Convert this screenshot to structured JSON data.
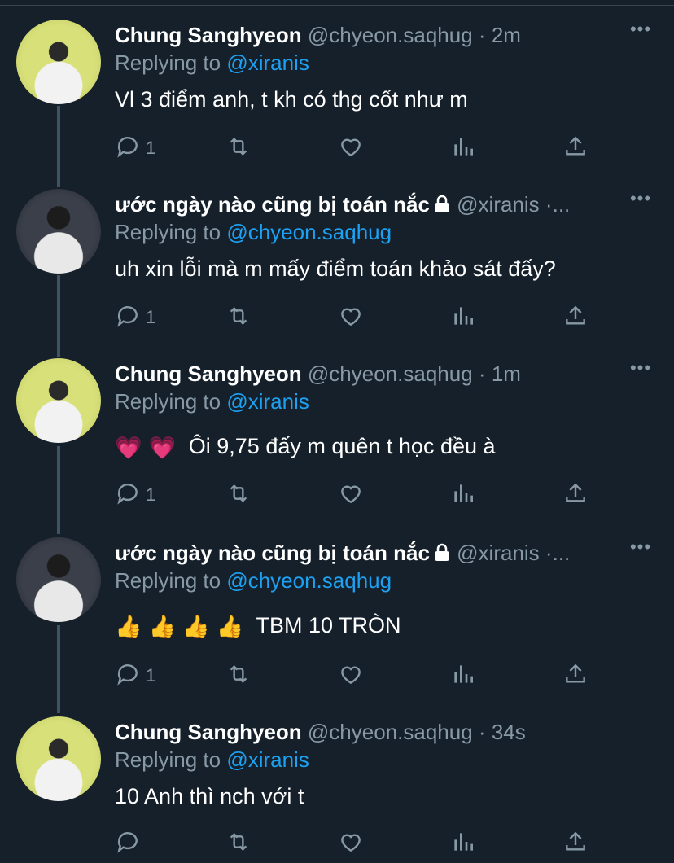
{
  "tweets": [
    {
      "name": "Chung Sanghyeon",
      "handle": "@chyeon.saqhug",
      "sep": "·",
      "time": "2m",
      "locked": false,
      "replying_prefix": "Replying to",
      "replying_to": "@xiranis",
      "text": "Vl 3 điểm anh, t kh có thg cốt như m",
      "emoji": [],
      "reply_count": "1",
      "more": "•••"
    },
    {
      "name": "ước ngày nào cũng bị toán nắc",
      "handle": "@xiranis",
      "sep": "·",
      "time": "...",
      "locked": true,
      "replying_prefix": "Replying to",
      "replying_to": "@chyeon.saqhug",
      "text": "uh xin lỗi mà m mấy điểm toán khảo sát đấy?",
      "emoji": [],
      "reply_count": "1",
      "more": "•••"
    },
    {
      "name": "Chung Sanghyeon",
      "handle": "@chyeon.saqhug",
      "sep": "·",
      "time": "1m",
      "locked": false,
      "replying_prefix": "Replying to",
      "replying_to": "@xiranis",
      "text": "Ôi 9,75 đấy m quên t học đều à",
      "emoji": [
        "💗",
        "💗"
      ],
      "reply_count": "1",
      "more": "•••"
    },
    {
      "name": "ước ngày nào cũng bị toán nắc",
      "handle": "@xiranis",
      "sep": "·",
      "time": "...",
      "locked": true,
      "replying_prefix": "Replying to",
      "replying_to": "@chyeon.saqhug",
      "text": "TBM 10 TRÒN",
      "emoji": [
        "👍",
        "👍",
        "👍",
        "👍"
      ],
      "reply_count": "1",
      "more": "•••"
    },
    {
      "name": "Chung Sanghyeon",
      "handle": "@chyeon.saqhug",
      "sep": "·",
      "time": "34s",
      "locked": false,
      "replying_prefix": "Replying to",
      "replying_to": "@xiranis",
      "text": "10 Anh thì nch với t",
      "emoji": [],
      "reply_count": "",
      "more": "•••"
    }
  ],
  "icons": {
    "reply": "reply-icon",
    "retweet": "retweet-icon",
    "like": "heart-icon",
    "analytics": "analytics-icon",
    "share": "share-icon",
    "lock": "lock-icon",
    "more": "more-icon"
  },
  "colors": {
    "background": "#15202b",
    "secondary_text": "#8899a6",
    "link": "#1da1f2",
    "thread_line": "#3d5466"
  }
}
